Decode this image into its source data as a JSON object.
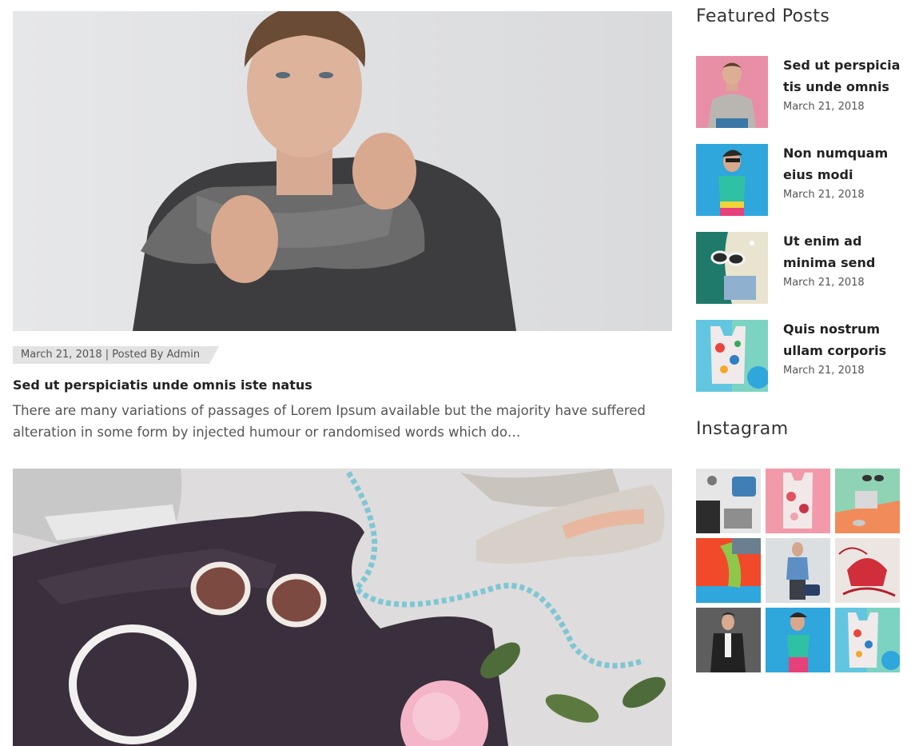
{
  "main": {
    "posts": [
      {
        "meta": "March 21, 2018 | Posted By Admin",
        "title": "Sed ut perspiciatis unde omnis iste natus",
        "excerpt": "There are many variations of passages of Lorem Ipsum available but the majority have suffered alteration in some form by injected humour or randomised words which do…"
      }
    ]
  },
  "sidebar": {
    "featured_title": "Featured Posts",
    "featured_posts": [
      {
        "title": "Sed ut perspicia tis unde omnis",
        "date": "March 21, 2018"
      },
      {
        "title": "Non numquam eius modi",
        "date": "March 21, 2018"
      },
      {
        "title": "Ut enim ad minima send",
        "date": "March 21, 2018"
      },
      {
        "title": "Quis nostrum ullam corporis",
        "date": "March 21, 2018"
      }
    ],
    "instagram_title": "Instagram"
  }
}
